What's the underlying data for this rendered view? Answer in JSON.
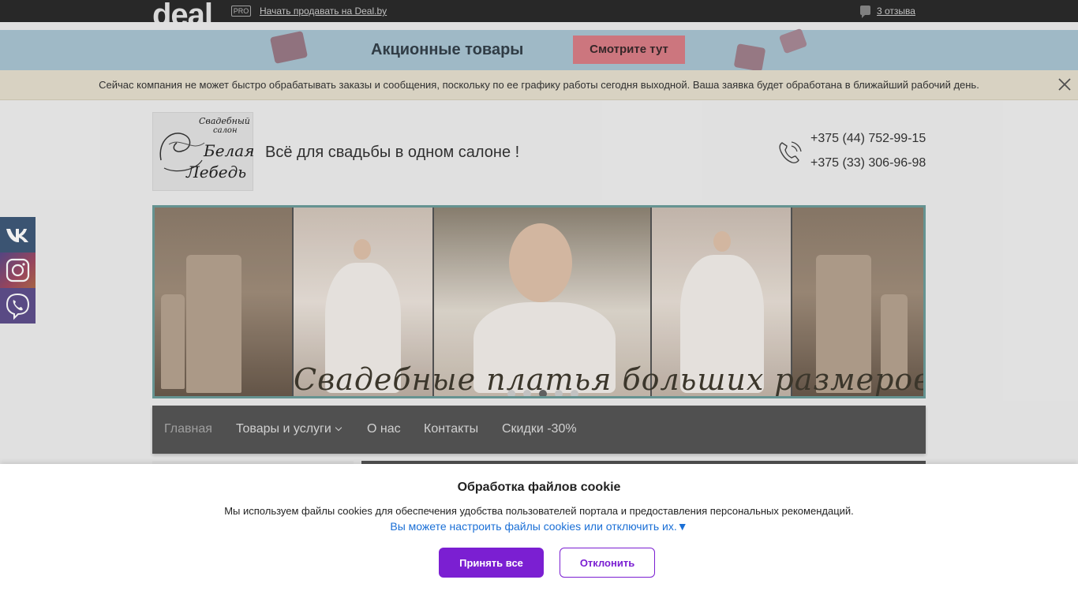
{
  "topbar": {
    "logo_text": "deal",
    "pro_badge": "PRO",
    "sell_link": "Начать продавать на Deal.by",
    "reviews_link": "3 отзыва",
    "reviews_icon": "comment-icon"
  },
  "promo": {
    "title": "Акционные товары",
    "button": "Смотрите тут"
  },
  "notice": {
    "text": "Сейчас компания не может быстро обрабатывать заказы и сообщения, поскольку по ее графику работы сегодня выходной. Ваша заявка будет обработана в ближайший рабочий день.",
    "close_icon": "close-icon"
  },
  "header": {
    "logo": {
      "line1": "Свадебный",
      "line2": "салон",
      "line3": "Белая",
      "line4": "Лебедь"
    },
    "slogan": "Всё для свадьбы в одном салоне !",
    "phones": [
      "+375 (44) 752-99-15",
      "+375 (33) 306-96-98"
    ],
    "phone_icon": "phone-icon"
  },
  "slider": {
    "caption": "Свадебные платья больших размеров",
    "dots": 5,
    "active_dot": 3
  },
  "nav": {
    "items": [
      {
        "label": "Главная",
        "active": true
      },
      {
        "label": "Товары и услуги",
        "dropdown": true
      },
      {
        "label": "О нас"
      },
      {
        "label": "Контакты"
      },
      {
        "label": "Скидки -30%"
      }
    ]
  },
  "social": [
    "vk-icon",
    "instagram-icon",
    "viber-icon"
  ],
  "cookie": {
    "title": "Обработка файлов cookie",
    "text": "Мы используем файлы cookies для обеспечения удобства пользователей портала и предоставления персональных рекомендаций.",
    "link": "Вы можете настроить файлы cookies или отключить их.▼",
    "accept": "Принять все",
    "reject": "Отклонить"
  },
  "colors": {
    "accent_purple": "#7b1fd2",
    "nav_bg": "#555555",
    "promo_bg": "#a9c5d3",
    "promo_button": "#d97e86",
    "slider_border": "#6c9d9b"
  }
}
